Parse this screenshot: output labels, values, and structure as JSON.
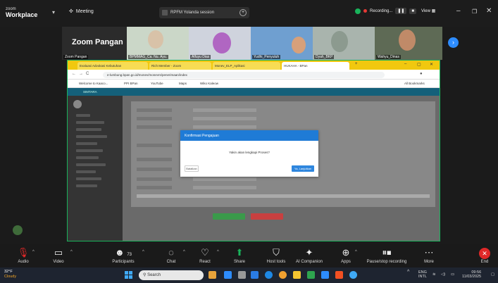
{
  "zoom_app": {
    "logo_line1": "zoom",
    "logo_line2": "Workplace"
  },
  "meeting": {
    "label": "Meeting",
    "center_label": "RPFM Yolanda session",
    "recording_label": "Recording...",
    "view_label": "View"
  },
  "participants_strip": {
    "name_tile": {
      "name": "Zoom Pangan",
      "label": "Zoom Pangan"
    },
    "tiles": [
      {
        "label": "BPMMAG_Ca. Nu. Ayu."
      },
      {
        "label": "Alfuyu Dias"
      },
      {
        "label": "Yudhi_Penyuluh"
      },
      {
        "label": "Dyah_BKP"
      },
      {
        "label": "Rofiqi Dias"
      },
      {
        "label": "Wahyu_Dinas"
      }
    ]
  },
  "browser": {
    "tabs": [
      {
        "label": "Evaluasi Advokasi Kebutuhan"
      },
      {
        "label": "Rich Member - Zoom"
      },
      {
        "label": "Monev_ELP_Aplikasi"
      },
      {
        "label": "HUKAHA - BPan"
      }
    ],
    "url": "e-lumbung.bpan.go.id/monev/monevrs/penerimaan/index",
    "bookmarks": [
      {
        "label": "Welcome to Kaaco..."
      },
      {
        "label": "PPI BPan"
      },
      {
        "label": "YouTube"
      },
      {
        "label": "Maps"
      },
      {
        "label": "Wiko Kaleow"
      },
      {
        "label": "All Bookmarks"
      }
    ]
  },
  "web_app": {
    "header_title": "SIMTARA",
    "modal": {
      "title": "Konfirmasi Pengajuan",
      "message": "Yakin akan lengkapi Proses?",
      "cancel_label": "Batalkan",
      "ok_label": "Ya, Lanjutkan"
    }
  },
  "toolbar": {
    "audio": "Audio",
    "video": "Video",
    "participants": "Participants",
    "participants_count": "73",
    "chat": "Chat",
    "react": "React",
    "share": "Share",
    "host_tools": "Host tools",
    "ai_companion": "AI Companion",
    "apps": "Apps",
    "pause_recording": "Pause/stop recording",
    "more": "More",
    "end": "End"
  },
  "taskbar": {
    "weather_temp": "32°F",
    "weather_cond": "Cloudy",
    "search_placeholder": "Search",
    "lang_line1": "ENG",
    "lang_line2": "INTL",
    "time": "09:56",
    "date": "11/03/2025"
  },
  "colors": {
    "zoom_blue": "#2d8cff",
    "end_red": "#e02828",
    "chrome_yellow": "#f1c80f",
    "modal_blue": "#1f7bd6",
    "active_border": "#19b35b"
  }
}
